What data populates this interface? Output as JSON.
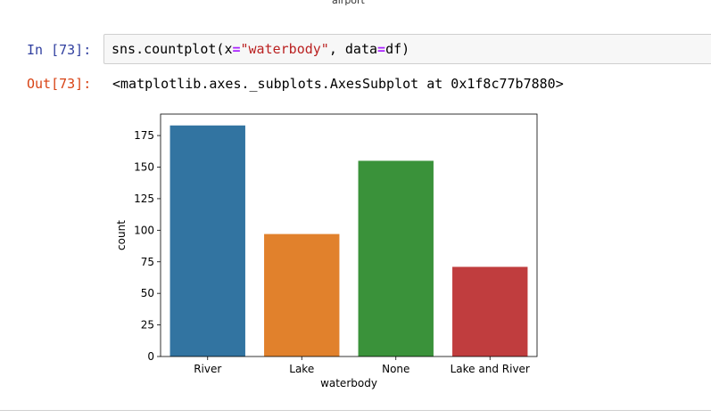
{
  "top_fragment": "airport",
  "input_cell": {
    "prompt": "In [73]:",
    "code": {
      "func": "sns.countplot",
      "open": "(",
      "arg1_key": "x",
      "eq1": "=",
      "arg1_val": "\"waterbody\"",
      "sep": ", ",
      "arg2_key": "data",
      "eq2": "=",
      "arg2_val": "df",
      "close": ")"
    }
  },
  "output_cell": {
    "prompt": "Out[73]:",
    "text": "<matplotlib.axes._subplots.AxesSubplot at 0x1f8c77b7880>"
  },
  "chart_data": {
    "type": "bar",
    "categories": [
      "River",
      "Lake",
      "None",
      "Lake and River"
    ],
    "values": [
      183,
      97,
      155,
      71
    ],
    "colors": [
      "#3274a1",
      "#e1812c",
      "#3a923a",
      "#c03d3e"
    ],
    "xlabel": "waterbody",
    "ylabel": "count",
    "ylim": [
      0,
      192
    ],
    "yticks": [
      0,
      25,
      50,
      75,
      100,
      125,
      150,
      175
    ],
    "grid": false
  }
}
